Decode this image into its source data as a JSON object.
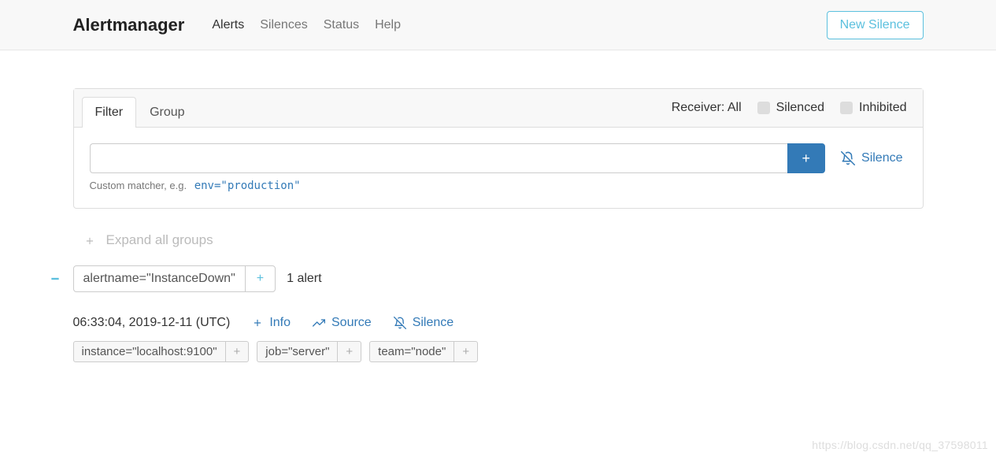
{
  "navbar": {
    "brand": "Alertmanager",
    "links": [
      "Alerts",
      "Silences",
      "Status",
      "Help"
    ],
    "new_silence": "New Silence"
  },
  "tabs": {
    "filter": "Filter",
    "group": "Group",
    "receiver_label": "Receiver: All",
    "silenced": "Silenced",
    "inhibited": "Inhibited"
  },
  "filter": {
    "placeholder": "",
    "add": "+",
    "silence": "Silence",
    "hint_prefix": "Custom matcher, e.g.",
    "hint_example": "env=\"production\""
  },
  "expand": "Expand all groups",
  "group": {
    "label": "alertname=\"InstanceDown\"",
    "add": "+",
    "count": "1 alert"
  },
  "alert": {
    "timestamp": "06:33:04, 2019-12-11 (UTC)",
    "info": "Info",
    "source": "Source",
    "silence": "Silence",
    "labels": [
      "instance=\"localhost:9100\"",
      "job=\"server\"",
      "team=\"node\""
    ],
    "label_add": "+"
  },
  "watermark": "https://blog.csdn.net/qq_37598011"
}
